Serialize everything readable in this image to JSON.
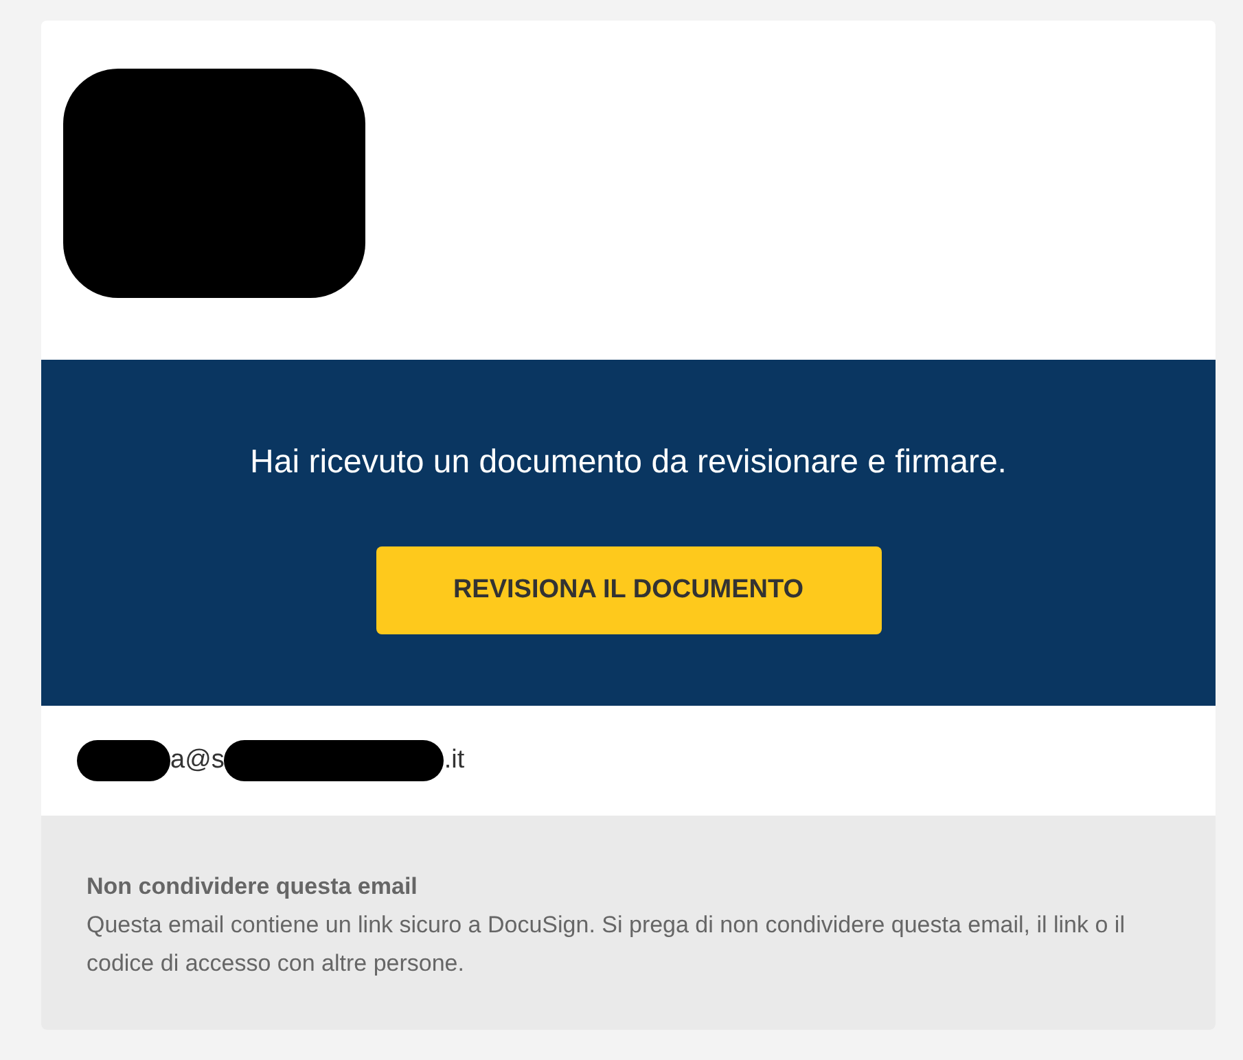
{
  "banner": {
    "message": "Hai ricevuto un documento da revisionare e firmare.",
    "button": "REVISIONA IL DOCUMENTO"
  },
  "sender_email": [
    {
      "kind": "redacted"
    },
    {
      "kind": "text",
      "text": "a@s"
    },
    {
      "kind": "redacted"
    },
    {
      "kind": "text",
      "text": ".it"
    }
  ],
  "notice": {
    "title": "Non condividere questa email",
    "body": "Questa email contiene un link sicuro a DocuSign. Si prega di non condividere questa email, il link o il codice di accesso con altre persone."
  }
}
